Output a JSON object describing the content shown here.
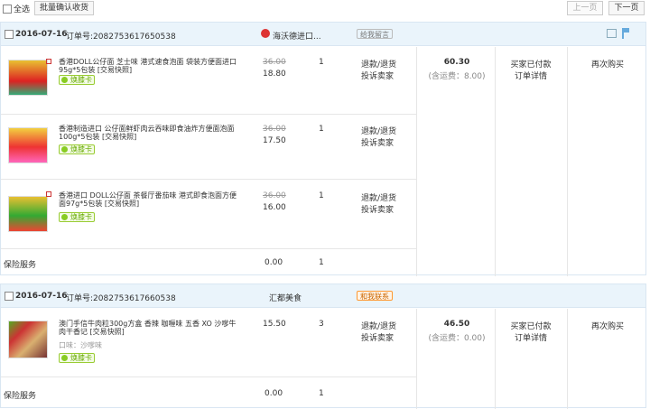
{
  "toolbar": {
    "select_all": "全选",
    "batch_confirm": "批量确认收货",
    "prev": "上一页",
    "next": "下一页"
  },
  "labels": {
    "order_no": "订单号:",
    "refund": "退款/退货",
    "complain": "投诉卖家",
    "freight_prefix": "(含运费：",
    "freight_suffix": ")",
    "buyer_paid": "买家已付款",
    "order_detail": "订单详情",
    "rebuy": "再次购买",
    "insurance": "保险服务",
    "huanke": "焕膝卡"
  },
  "orders": [
    {
      "date": "2016-07-16",
      "order_no": "2082753617650538",
      "shop": "海沃德进口...",
      "badge": "给我留言",
      "total": "60.30",
      "freight": "8.00",
      "items": [
        {
          "title": "香港DOLL公仔面 芝士味 港式速食泡面 袋装方便面进口 95g*5包装 [交易快照]",
          "orig": "36.00",
          "price": "18.80",
          "qty": "1"
        },
        {
          "title": "香港制造进口 公仔面鲜虾肉云吞味即食油炸方便面泡面 100g*5包装 [交易快照]",
          "orig": "36.00",
          "price": "17.50",
          "qty": "1"
        },
        {
          "title": "香港进口 DOLL公仔面 茶餐厅番茄味 港式即食泡面方便 面97g*5包装 [交易快照]",
          "orig": "36.00",
          "price": "16.00",
          "qty": "1"
        }
      ],
      "insurance": {
        "price": "0.00",
        "qty": "1"
      }
    },
    {
      "date": "2016-07-16",
      "order_no": "2082753617660538",
      "shop": "汇都美食",
      "badge": "和我联系",
      "total": "46.50",
      "freight": "0.00",
      "items": [
        {
          "title": "澳门手信牛肉粒300g方盒 香辣 咖喱味 五香 XO 沙嗲牛 肉干香记 [交易快照]",
          "variant": "口味：沙嗲味",
          "orig": "",
          "price": "15.50",
          "qty": "3"
        }
      ],
      "insurance": {
        "price": "0.00",
        "qty": "1"
      }
    }
  ]
}
